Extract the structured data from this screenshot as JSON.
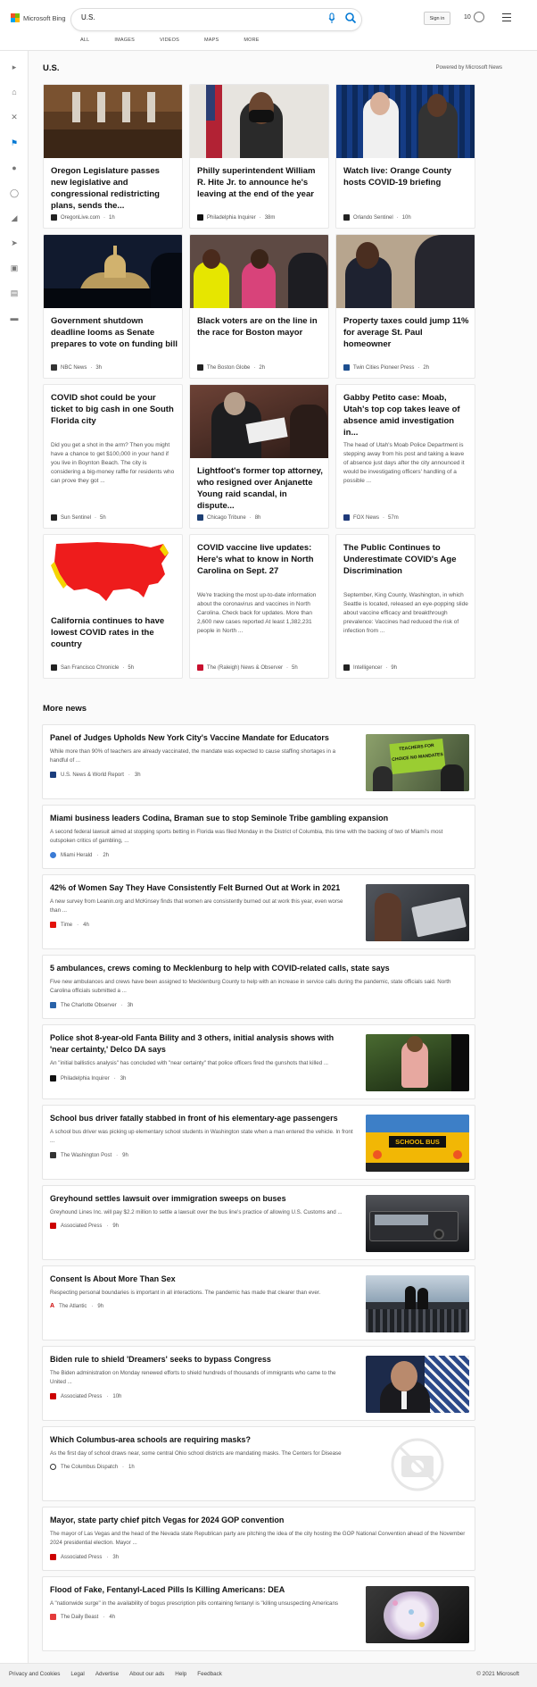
{
  "header": {
    "logo_text": "Microsoft Bing",
    "search_value": "U.S.",
    "signin": "Sign in",
    "points": "10",
    "tabs": [
      "ALL",
      "IMAGES",
      "VIDEOS",
      "MAPS",
      "MORE"
    ]
  },
  "main": {
    "section_title": "U.S.",
    "powered_by": "Powered by Microsoft News",
    "cards": [
      {
        "title": "Oregon Legislature passes new legislative and congressional redistricting plans, sends the...",
        "source": "OregonLive.com",
        "time": "1h"
      },
      {
        "title": "Philly superintendent William R. Hite Jr. to announce he's leaving at the end of the year",
        "source": "Philadelphia Inquirer",
        "time": "38m"
      },
      {
        "title": "Watch live: Orange County hosts COVID-19 briefing",
        "source": "Orlando Sentinel",
        "time": "10h"
      },
      {
        "title": "Government shutdown deadline looms as Senate prepares to vote on funding bill",
        "source": "NBC News",
        "time": "3h"
      },
      {
        "title": "Black voters are on the line in the race for Boston mayor",
        "source": "The Boston Globe",
        "time": "2h"
      },
      {
        "title": "Property taxes could jump 11% for average St. Paul homeowner",
        "source": "Twin Cities Pioneer Press",
        "time": "2h"
      },
      {
        "title": "COVID shot could be your ticket to big cash in one South Florida city",
        "snippet": "Did you get a shot in the arm? Then you might have a chance to get $100,000 in your hand if you live in Boynton Beach. The city is considering a big-money raffle for residents who can prove they got ...",
        "source": "Sun Sentinel",
        "time": "5h"
      },
      {
        "title": "Lightfoot's former top attorney, who resigned over Anjanette Young raid scandal, in dispute...",
        "source": "Chicago Tribune",
        "time": "8h"
      },
      {
        "title": "Gabby Petito case: Moab, Utah's top cop takes leave of absence amid investigation in...",
        "snippet": "The head of Utah's Moab Police Department is stepping away from his post and taking a leave of absence just days after the city announced it would be investigating officers' handling of a possible ...",
        "source": "FOX News",
        "time": "57m"
      },
      {
        "title": "California continues to have lowest COVID rates in the country",
        "source": "San Francisco Chronicle",
        "time": "5h"
      },
      {
        "title": "COVID vaccine live updates: Here's what to know in North Carolina on Sept. 27",
        "snippet": "We're tracking the most up-to-date information about the coronavirus and vaccines in North Carolina. Check back for updates. More than 2,600 new cases reported At least 1,382,231 people in North ...",
        "source": "The (Raleigh) News & Observer",
        "time": "5h"
      },
      {
        "title": "The Public Continues to Underestimate COVID's Age Discrimination",
        "snippet": "September, King County, Washington, in which Seattle is located, released an eye-popping slide about vaccine efficacy and breakthrough prevalence: Vaccines had reduced the risk of infection from ...",
        "source": "Intelligencer",
        "time": "9h"
      }
    ],
    "more_title": "More news",
    "news": [
      {
        "title": "Panel of Judges Upholds New York City's Vaccine Mandate for Educators",
        "desc": "While more than 90% of teachers are already vaccinated, the mandate was expected to cause staffing shortages in a handful of ...",
        "source": "U.S. News & World Report",
        "time": "3h",
        "img_text": "TEACHERS FOR CHOICE NO MANDATES"
      },
      {
        "title": "Miami business leaders Codina, Braman sue to stop Seminole Tribe gambling expansion",
        "desc": "A second federal lawsuit aimed at stopping sports betting in Florida was filed Monday in the District of Columbia, this time with the backing of two of Miami's most outspoken critics of gambling, ...",
        "source": "Miami Herald",
        "time": "2h"
      },
      {
        "title": "42% of Women Say They Have Consistently Felt Burned Out at Work in 2021",
        "desc": "A new survey from Leanin.org and McKinsey finds that women are consistently burned out at work this year, even worse than ...",
        "source": "Time",
        "time": "4h"
      },
      {
        "title": "5 ambulances, crews coming to Mecklenburg to help with COVID-related calls, state says",
        "desc": "Five new ambulances and crews have been assigned to Mecklenburg County to help with an increase in service calls during the pandemic, state officials said. North Carolina officials submitted a ...",
        "source": "The Charlotte Observer",
        "time": "3h"
      },
      {
        "title": "Police shot 8-year-old Fanta Bility and 3 others, initial analysis shows with 'near certainty,' Delco DA says",
        "desc": "An \"initial ballistics analysis\" has concluded with \"near certainty\" that police officers fired the gunshots that killed ...",
        "source": "Philadelphia Inquirer",
        "time": "3h"
      },
      {
        "title": "School bus driver fatally stabbed in front of his elementary-age passengers",
        "desc": "A school bus driver was picking up elementary school students in Washington state when a man entered the vehicle. In front ...",
        "source": "The Washington Post",
        "time": "9h",
        "img_text": "SCHOOL BUS"
      },
      {
        "title": "Greyhound settles lawsuit over immigration sweeps on buses",
        "desc": "Greyhound Lines Inc. will pay $2.2 million to settle a lawsuit over the bus line's practice of allowing U.S. Customs and ...",
        "source": "Associated Press",
        "time": "9h"
      },
      {
        "title": "Consent Is About More Than Sex",
        "desc": "Respecting personal boundaries is important in all interactions. The pandemic has made that clearer than ever.",
        "source": "The Atlantic",
        "time": "9h"
      },
      {
        "title": "Biden rule to shield 'Dreamers' seeks to bypass Congress",
        "desc": "The Biden administration on Monday renewed efforts to shield hundreds of thousands of immigrants who came to the United ...",
        "source": "Associated Press",
        "time": "10h"
      },
      {
        "title": "Which Columbus-area schools are requiring masks?",
        "desc": "As the first day of school draws near, some central Ohio school districts are mandating masks. The Centers for Disease",
        "source": "The Columbus Dispatch",
        "time": "1h"
      },
      {
        "title": "Mayor, state party chief pitch Vegas for 2024 GOP convention",
        "desc": "The mayor of Las Vegas and the head of the Nevada state Republican party are pitching the idea of the city hosting the GOP National Convention ahead of the November 2024 presidential election. Mayor ...",
        "source": "Associated Press",
        "time": "3h"
      },
      {
        "title": "Flood of Fake, Fentanyl-Laced Pills Is Killing Americans: DEA",
        "desc": "A \"nationwide surge\" in the availability of bogus prescription pills containing fentanyl is \"killing unsuspecting Americans",
        "source": "The Daily Beast",
        "time": "4h"
      }
    ]
  },
  "footer": {
    "links": [
      "Privacy and Cookies",
      "Legal",
      "Advertise",
      "About our ads",
      "Help",
      "Feedback"
    ],
    "copyright": "© 2021 Microsoft"
  },
  "colors": {
    "accent": "#0078d4",
    "bing_blue": "#0078d4"
  }
}
